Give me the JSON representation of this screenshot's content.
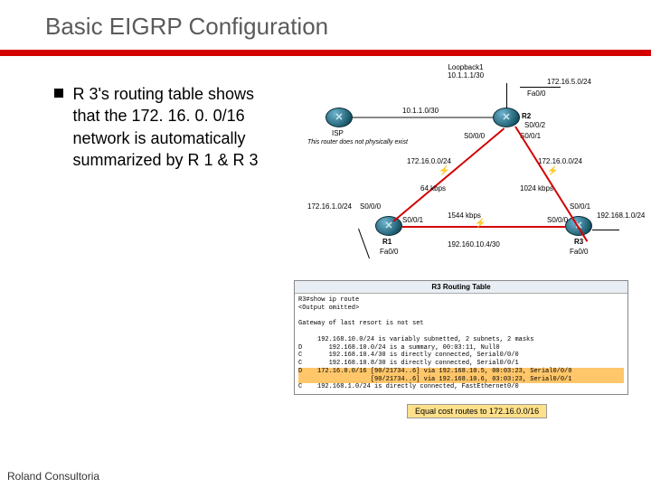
{
  "title": "Basic EIGRP Configuration",
  "bullet": "R 3's routing table shows that the 172. 16. 0. 0/16 network is automatically summarized by R 1 & R 3",
  "footer": "Roland Consultoria",
  "diagram": {
    "note": "This router does not physically exist",
    "loopback": {
      "name": "Loopback1",
      "addr": "10.1.1.1/30"
    },
    "isp": "ISP",
    "r1": "R1",
    "r2": "R2",
    "r3": "R3",
    "nets": {
      "top_right": "172.16.5.0/24",
      "r2_left": "172.16.0.0/24",
      "r2_loop": "10.1.1.0/30",
      "r1r2": "172.16.0.0/24",
      "r2r3": "172.16.0.0/24",
      "r1r3": "192.160.10.4/30",
      "r1_lan": "172.16.1.0/24",
      "r3_lan": "192.168.1.0/24"
    },
    "iface": {
      "fa00": "Fa0/0",
      "s000": "S0/0/0",
      "s001": "S0/0/1",
      "s002": "S0/0/2"
    },
    "bw": {
      "left": "64 kbps",
      "right": "1024 kbps",
      "bottom": "1544 kbps"
    }
  },
  "routing": {
    "header": "R3 Routing Table",
    "cmd": "R3#show ip route",
    "omit": "<Output omitted>",
    "gateway": "Gateway of last resort is not set",
    "l1": "     192.168.10.0/24 is variably subnetted, 2 subnets, 2 masks",
    "l2": "D       192.168.10.0/24 is a summary, 00:03:11, Null0",
    "l3": "C       192.168.10.4/30 is directly connected, Serial0/0/0",
    "l4": "C       192.168.10.8/30 is directly connected, Serial0/0/1",
    "hl1": "D    172.16.0.0/16 [90/21734..6] via 192.168.10.5, 00:03:23, Serial0/0/0",
    "hl2": "                   [90/21734..6] via 192.168.10.6, 03:03:23, Serial0/0/1",
    "l5": "C    192.168.1.0/24 is directly connected, FastEthernet0/0"
  },
  "callout": "Equal cost routes to 172.16.0.0/16"
}
